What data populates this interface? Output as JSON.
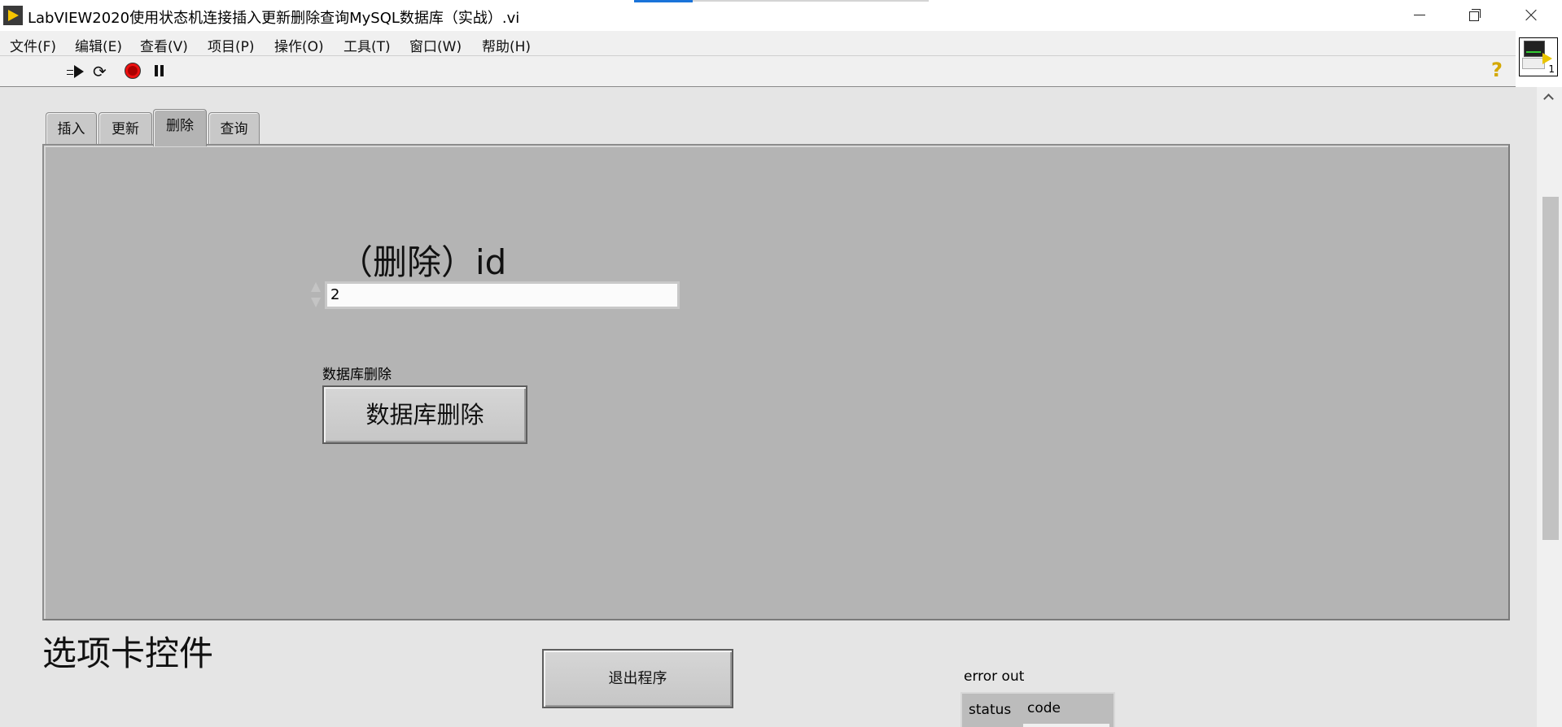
{
  "window": {
    "title": "LabVIEW2020使用状态机连接插入更新删除查询MySQL数据库（实战）.vi",
    "accent_color": "#1a73d9"
  },
  "menu": {
    "items": [
      "文件(F)",
      "编辑(E)",
      "查看(V)",
      "项目(P)",
      "操作(O)",
      "工具(T)",
      "窗口(W)",
      "帮助(H)"
    ]
  },
  "toolbar": {
    "icons": [
      "run-arrow-icon",
      "run-continuously-icon",
      "abort-icon",
      "pause-icon"
    ],
    "help_glyph": "?",
    "vi_icon_number": "1"
  },
  "tabs": {
    "items": [
      "插入",
      "更新",
      "删除",
      "查询"
    ],
    "active": "删除",
    "caption": "选项卡控件"
  },
  "delete_page": {
    "id_label": "（删除）id",
    "id_value": "2",
    "button_label": "数据库删除",
    "button_text": "数据库删除"
  },
  "exit_button": {
    "text": "退出程序"
  },
  "error_out": {
    "label": "error out",
    "status_label": "status",
    "code_label": "code"
  },
  "colors": {
    "panel_background": "#e5e5e5",
    "tab_page": "#b4b4b4",
    "help_icon": "#d4a800",
    "abort": "#e11111"
  }
}
